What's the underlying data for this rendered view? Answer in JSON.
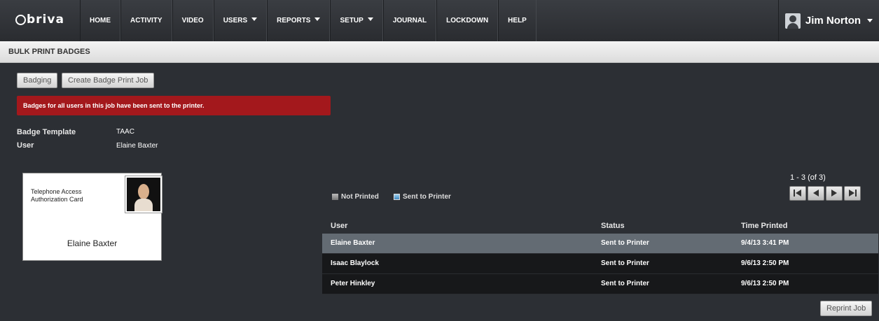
{
  "logo": "briva",
  "nav": [
    {
      "label": "HOME",
      "dropdown": false
    },
    {
      "label": "ACTIVITY",
      "dropdown": false
    },
    {
      "label": "VIDEO",
      "dropdown": false
    },
    {
      "label": "USERS",
      "dropdown": true
    },
    {
      "label": "REPORTS",
      "dropdown": true
    },
    {
      "label": "SETUP",
      "dropdown": true
    },
    {
      "label": "JOURNAL",
      "dropdown": false
    },
    {
      "label": "LOCKDOWN",
      "dropdown": false
    },
    {
      "label": "HELP",
      "dropdown": false
    }
  ],
  "user": {
    "name": "Jim Norton"
  },
  "page_title": "BULK PRINT BADGES",
  "buttons": {
    "badging": "Badging",
    "create": "Create Badge Print Job",
    "reprint": "Reprint Job"
  },
  "alert": {
    "text": "Badges for all users in this job have been sent to the printer.",
    "color": "#a3181c"
  },
  "info": {
    "template_label": "Badge Template",
    "template_value": "TAAC",
    "user_label": "User",
    "user_value": "Elaine Baxter"
  },
  "card": {
    "line1": "Telephone Access",
    "line2": "Authorization Card",
    "name": "Elaine Baxter"
  },
  "legend": {
    "not_printed": "Not Printed",
    "sent": "Sent to Printer"
  },
  "pager": {
    "count": "1 - 3 (of 3)"
  },
  "table": {
    "headers": [
      "User",
      "Status",
      "Time Printed"
    ],
    "rows": [
      {
        "user": "Elaine Baxter",
        "status": "Sent to Printer",
        "time": "9/4/13 3:41 PM",
        "selected": true
      },
      {
        "user": "Isaac Blaylock",
        "status": "Sent to Printer",
        "time": "9/6/13 2:50 PM",
        "selected": false
      },
      {
        "user": "Peter Hinkley",
        "status": "Sent to Printer",
        "time": "9/6/13 2:50 PM",
        "selected": false
      }
    ]
  }
}
